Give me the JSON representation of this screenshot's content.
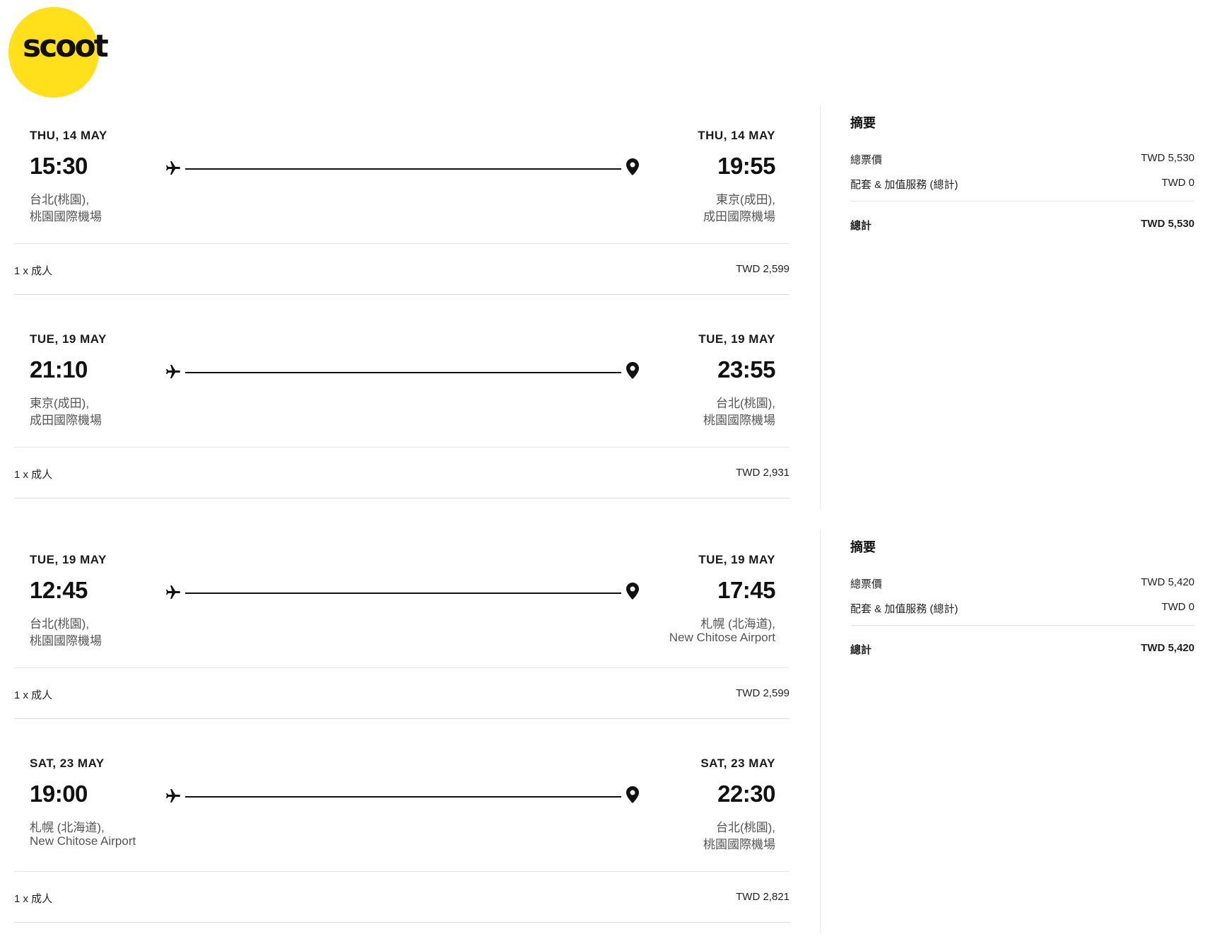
{
  "logo": {
    "text": "scoot",
    "color": "#ffe01b"
  },
  "bookings": [
    {
      "flights": [
        {
          "departure": {
            "date": "THU, 14 MAY",
            "time": "15:30",
            "city": "台北(桃園),",
            "airport": "桃園國際機場"
          },
          "arrival": {
            "date": "THU, 14 MAY",
            "time": "19:55",
            "city": "東京(成田),",
            "airport": "成田國際機場"
          },
          "passengers": "1 x 成人",
          "fare": "TWD 2,599"
        },
        {
          "departure": {
            "date": "TUE, 19 MAY",
            "time": "21:10",
            "city": "東京(成田),",
            "airport": "成田國際機場"
          },
          "arrival": {
            "date": "TUE, 19 MAY",
            "time": "23:55",
            "city": "台北(桃園),",
            "airport": "桃園國際機場"
          },
          "passengers": "1 x 成人",
          "fare": "TWD 2,931"
        }
      ],
      "summary": {
        "title": "摘要",
        "ticket_label": "總票價",
        "ticket_value": "TWD 5,530",
        "addons_label": "配套 & 加值服務 (總計)",
        "addons_value": "TWD 0",
        "total_label": "總計",
        "total_value": "TWD 5,530"
      }
    },
    {
      "flights": [
        {
          "departure": {
            "date": "TUE, 19 MAY",
            "time": "12:45",
            "city": "台北(桃園),",
            "airport": "桃園國際機場"
          },
          "arrival": {
            "date": "TUE, 19 MAY",
            "time": "17:45",
            "city": "札幌 (北海道),",
            "airport": "New Chitose Airport"
          },
          "passengers": "1 x 成人",
          "fare": "TWD 2,599"
        },
        {
          "departure": {
            "date": "SAT, 23 MAY",
            "time": "19:00",
            "city": "札幌 (北海道),",
            "airport": "New Chitose Airport"
          },
          "arrival": {
            "date": "SAT, 23 MAY",
            "time": "22:30",
            "city": "台北(桃園),",
            "airport": "桃園國際機場"
          },
          "passengers": "1 x 成人",
          "fare": "TWD 2,821"
        }
      ],
      "summary": {
        "title": "摘要",
        "ticket_label": "總票價",
        "ticket_value": "TWD 5,420",
        "addons_label": "配套 & 加值服務 (總計)",
        "addons_value": "TWD 0",
        "total_label": "總計",
        "total_value": "TWD 5,420"
      }
    }
  ]
}
